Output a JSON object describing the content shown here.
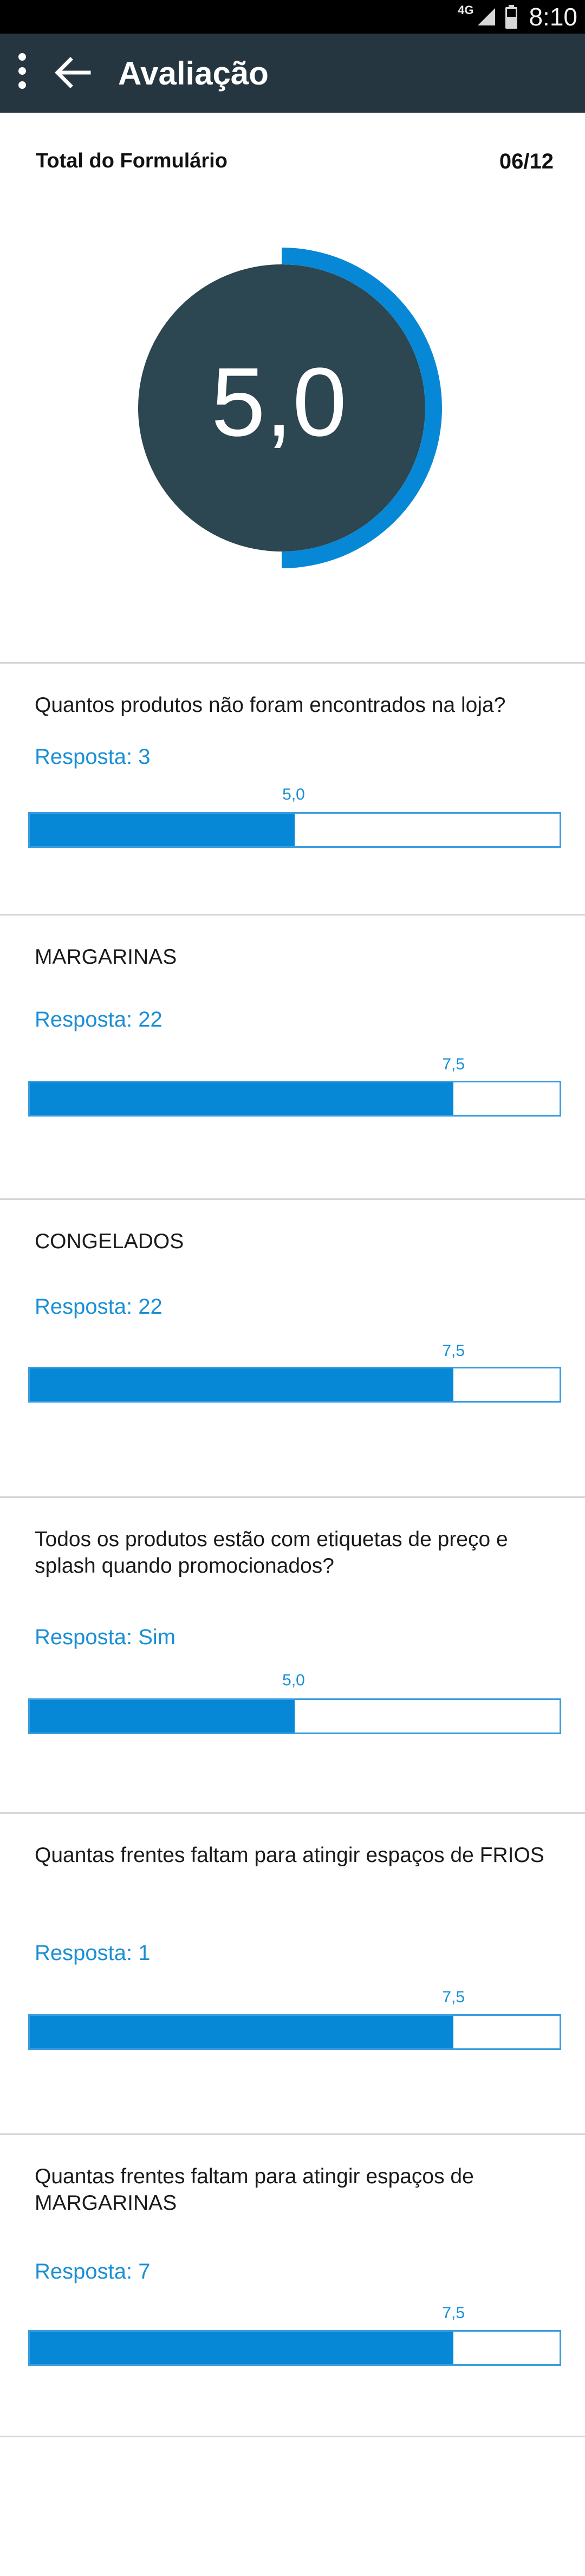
{
  "status": {
    "network": "4G",
    "time": "8:10"
  },
  "appbar": {
    "title": "Avaliação"
  },
  "summary": {
    "label": "Total do Formulário",
    "count": "06/12",
    "score": "5,0",
    "score_fraction": 0.5
  },
  "colors": {
    "accent": "#0688d6",
    "dark": "#2c4652",
    "appbar": "#253640"
  },
  "questions": [
    {
      "text": "Quantos produtos não foram encontrados na loja?",
      "answer": "Resposta: 3",
      "score": "5,0",
      "fraction": 0.5
    },
    {
      "text": "MARGARINAS",
      "answer": "Resposta: 22",
      "score": "7,5",
      "fraction": 0.8
    },
    {
      "text": "CONGELADOS",
      "answer": "Resposta: 22",
      "score": "7,5",
      "fraction": 0.8
    },
    {
      "text": "Todos os produtos estão com etiquetas de preço e splash quando promocionados?",
      "answer": "Resposta: Sim",
      "score": "5,0",
      "fraction": 0.5
    },
    {
      "text": "Quantas frentes faltam para atingir espaços de FRIOS",
      "answer": "Resposta: 1",
      "score": "7,5",
      "fraction": 0.8
    },
    {
      "text": "Quantas frentes faltam para atingir espaços de MARGARINAS",
      "answer": "Resposta: 7",
      "score": "7,5",
      "fraction": 0.8
    }
  ]
}
